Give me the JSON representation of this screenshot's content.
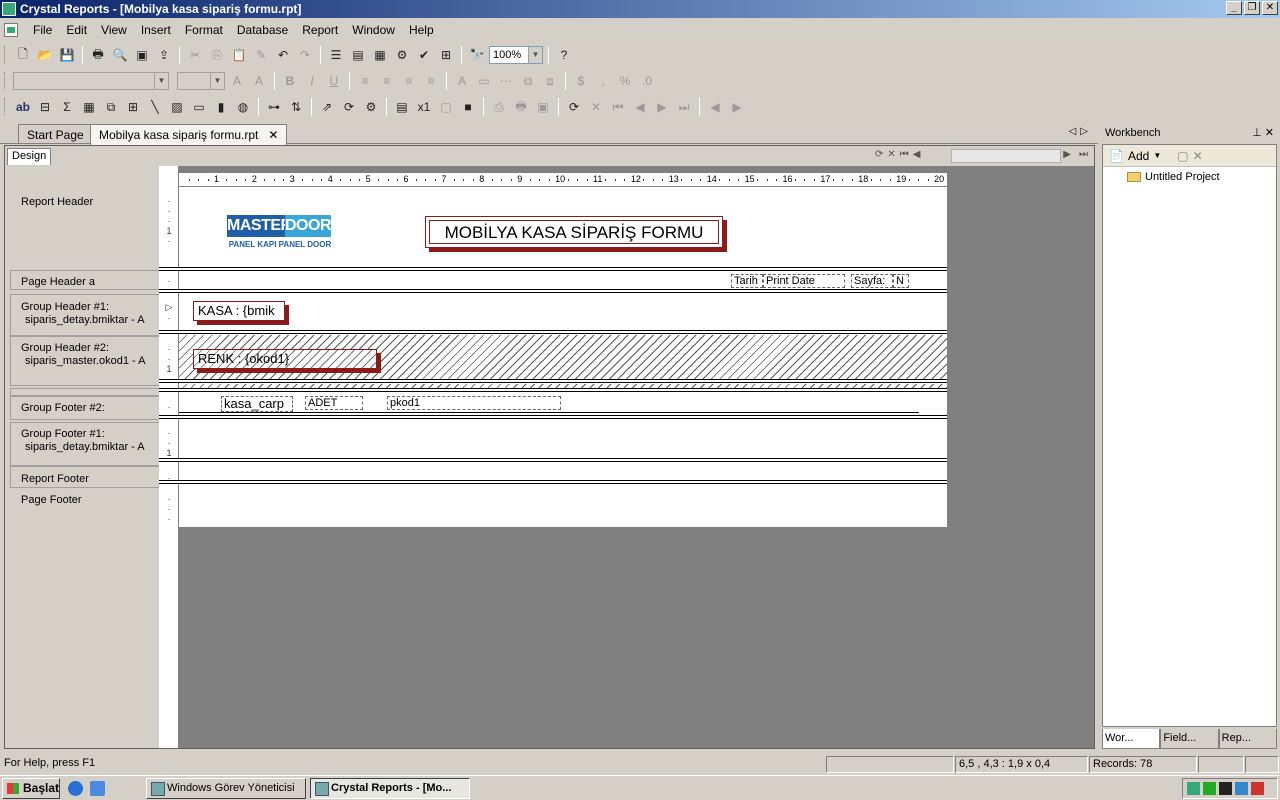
{
  "window": {
    "title": "Crystal Reports - [Mobilya kasa sipariş formu.rpt]",
    "controls": [
      "_",
      "❐",
      "✕"
    ]
  },
  "menu": [
    "File",
    "Edit",
    "View",
    "Insert",
    "Format",
    "Database",
    "Report",
    "Window",
    "Help"
  ],
  "toolbar": {
    "zoom": "100%"
  },
  "tabs": {
    "start_page": "Start Page",
    "active_doc": "Mobilya kasa sipariş formu.rpt",
    "close": "✕"
  },
  "design": {
    "tab_label": "Design",
    "ruler": [
      "1",
      "2",
      "3",
      "4",
      "5",
      "6",
      "7",
      "8",
      "9",
      "10",
      "11",
      "12",
      "13",
      "14",
      "15",
      "16",
      "17",
      "18",
      "19",
      "20"
    ],
    "sections": {
      "report_header": "Report Header",
      "page_header": "Page Header a",
      "group_header_1": "Group Header #1:",
      "group_header_1_sub": "siparis_detay.bmiktar - A",
      "group_header_2": "Group Header #2:",
      "group_header_2_sub": "siparis_master.okod1 - A",
      "group_footer_2": "Group Footer #2:",
      "group_footer_1": "Group Footer #1:",
      "group_footer_1_sub": "siparis_detay.bmiktar - A",
      "report_footer": "Report Footer",
      "page_footer": "Page Footer"
    },
    "logo": {
      "master": "MASTER",
      "door": "DOOR",
      "tagline": "PANEL KAPI PANEL DOOR"
    },
    "report_title": "MOBİLYA KASA SİPARİŞ FORMU",
    "page_header_fields": {
      "tarih_label": "Tarih :",
      "print_date": "Print Date",
      "sayfa_label": "Sayfa:",
      "page_no": "N"
    },
    "group1_field": "KASA :  {bmik",
    "group2_field": "RENK :  {okod1}",
    "footer2_fields": {
      "kasa": "kasa_carp",
      "adet": "ADET",
      "pkod": "pkod1"
    }
  },
  "workbench": {
    "title": "Workbench",
    "add_label": "Add",
    "project": "Untitled Project",
    "tabs": [
      "Wor...",
      "Field...",
      "Rep..."
    ]
  },
  "status": {
    "help": "For Help, press F1",
    "position": "6,5 , 4,3 : 1,9 x 0,4",
    "records": "Records: 78"
  },
  "taskbar": {
    "start": "Başlat",
    "tasks": [
      "Windows Görev Yöneticisi",
      "Crystal Reports - [Mo..."
    ]
  }
}
